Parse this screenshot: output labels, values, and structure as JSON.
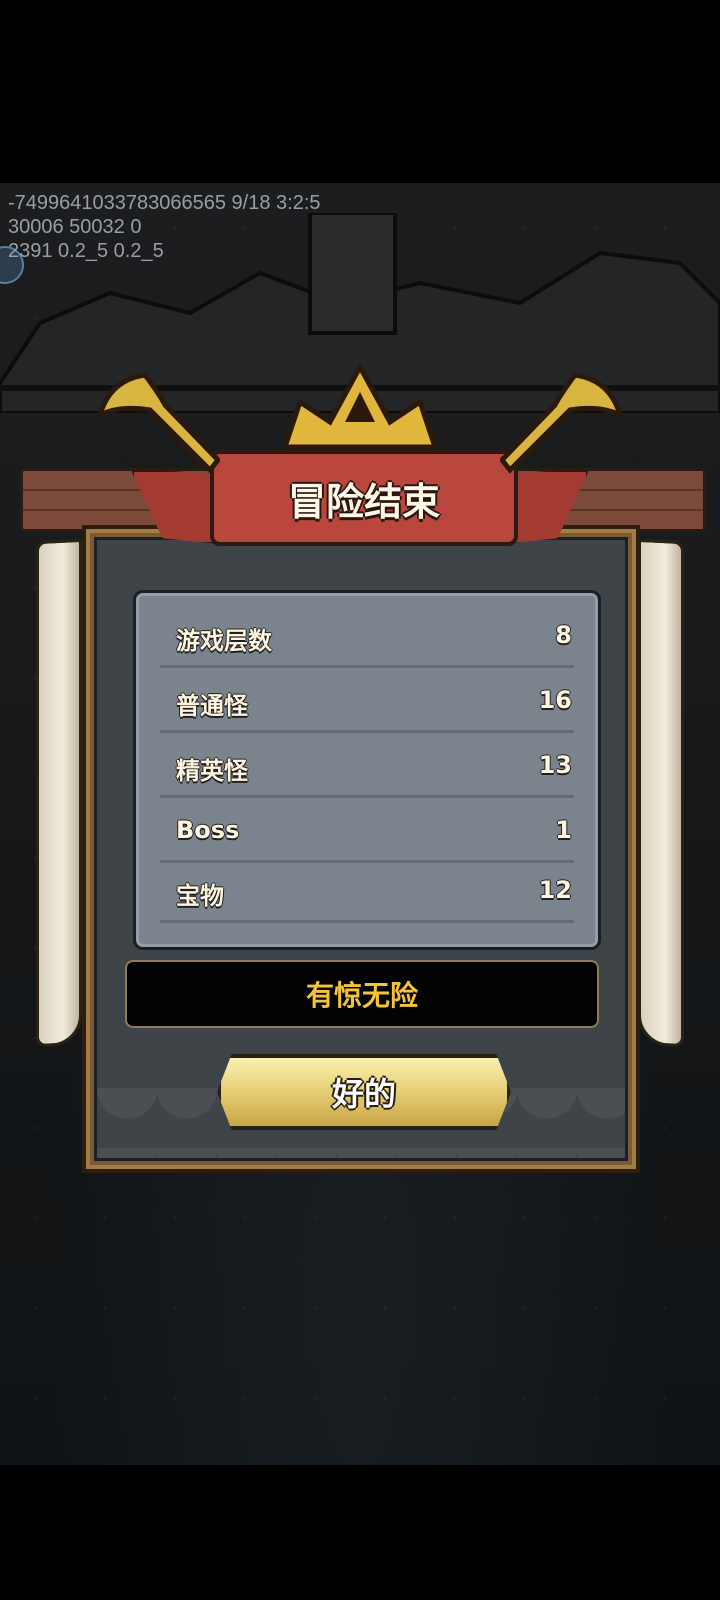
{
  "debug": {
    "line1": "-7499641033783066565 9/18 3:2:5",
    "line2": "30006 50032 0",
    "line3": "2391 0.2_5 0.2_5"
  },
  "popup": {
    "title": "冒险结束",
    "stats": [
      {
        "label": "游戏层数",
        "value": "8"
      },
      {
        "label": "普通怪",
        "value": "16"
      },
      {
        "label": "精英怪",
        "value": "13"
      },
      {
        "label": "Boss",
        "value": "1"
      },
      {
        "label": "宝物",
        "value": "12"
      }
    ],
    "result": "有惊无险",
    "ok_button": "好的"
  },
  "colors": {
    "ribbon": "#b9473d",
    "result_text": "#f4c33a",
    "button_gold": "#e7d27a"
  }
}
